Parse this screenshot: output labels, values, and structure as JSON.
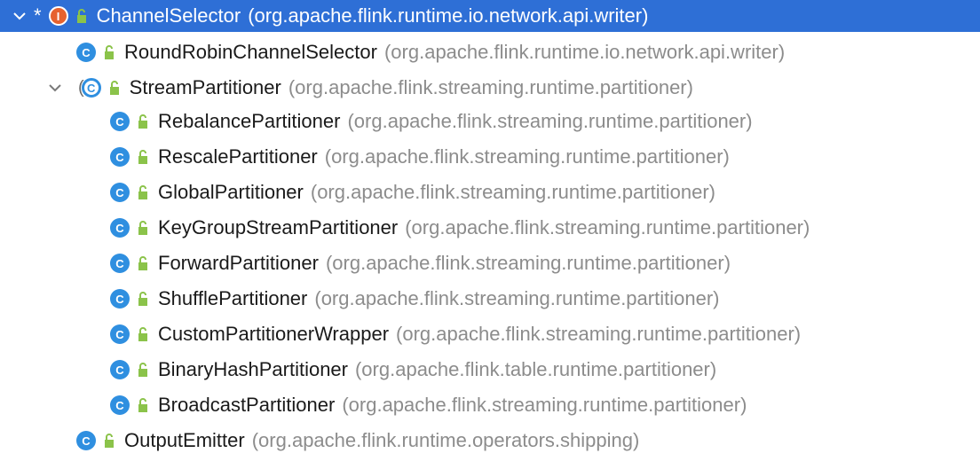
{
  "tree": {
    "root": {
      "name": "ChannelSelector",
      "package": "(org.apache.flink.runtime.io.network.api.writer)",
      "kind_icon_letter": "I",
      "icon": "interface-icon",
      "expanded": true,
      "selected": true
    },
    "children": [
      {
        "name": "RoundRobinChannelSelector",
        "package": "(org.apache.flink.runtime.io.network.api.writer)",
        "kind_icon_letter": "C",
        "icon": "class-icon"
      },
      {
        "name": "StreamPartitioner",
        "package": "(org.apache.flink.streaming.runtime.partitioner)",
        "kind_icon_letter": "C",
        "icon": "abstract-class-icon",
        "expanded": true
      },
      {
        "name": "RebalancePartitioner",
        "package": "(org.apache.flink.streaming.runtime.partitioner)",
        "kind_icon_letter": "C",
        "icon": "class-icon"
      },
      {
        "name": "RescalePartitioner",
        "package": "(org.apache.flink.streaming.runtime.partitioner)",
        "kind_icon_letter": "C",
        "icon": "class-icon"
      },
      {
        "name": "GlobalPartitioner",
        "package": "(org.apache.flink.streaming.runtime.partitioner)",
        "kind_icon_letter": "C",
        "icon": "class-icon"
      },
      {
        "name": "KeyGroupStreamPartitioner",
        "package": "(org.apache.flink.streaming.runtime.partitioner)",
        "kind_icon_letter": "C",
        "icon": "class-icon"
      },
      {
        "name": "ForwardPartitioner",
        "package": "(org.apache.flink.streaming.runtime.partitioner)",
        "kind_icon_letter": "C",
        "icon": "class-icon"
      },
      {
        "name": "ShufflePartitioner",
        "package": "(org.apache.flink.streaming.runtime.partitioner)",
        "kind_icon_letter": "C",
        "icon": "class-icon"
      },
      {
        "name": "CustomPartitionerWrapper",
        "package": "(org.apache.flink.streaming.runtime.partitioner)",
        "kind_icon_letter": "C",
        "icon": "class-icon"
      },
      {
        "name": "BinaryHashPartitioner",
        "package": "(org.apache.flink.table.runtime.partitioner)",
        "kind_icon_letter": "C",
        "icon": "class-icon"
      },
      {
        "name": "BroadcastPartitioner",
        "package": "(org.apache.flink.streaming.runtime.partitioner)",
        "kind_icon_letter": "C",
        "icon": "class-icon"
      },
      {
        "name": "OutputEmitter",
        "package": "(org.apache.flink.runtime.operators.shipping)",
        "kind_icon_letter": "C",
        "icon": "class-icon"
      }
    ],
    "root_marker": "*",
    "abstract_bracket": "(",
    "colors": {
      "selection": "#2e6fd6",
      "class_icon": "#2f8fe0",
      "interface_icon": "#e6622f",
      "lock_icon": "#8bc34a",
      "package_text": "#8c8c8c"
    }
  }
}
